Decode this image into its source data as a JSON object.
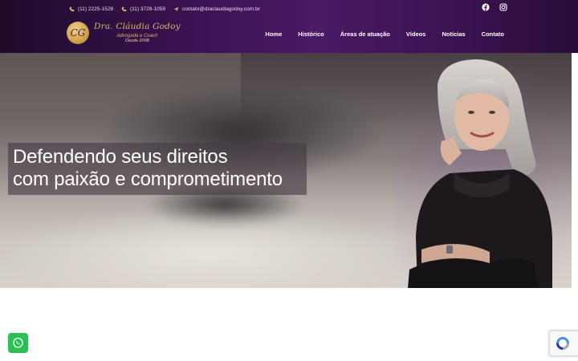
{
  "topbar": {
    "phone1": "(11) 2225-1528",
    "phone2": "(11) 3729-1059",
    "email": "contato@draclaudiagodoy.com.br"
  },
  "social": {
    "facebook_icon": "facebook-icon",
    "instagram_icon": "instagram-icon"
  },
  "logo": {
    "monogram": "CG",
    "name": "Dra. Cláudia Godoy",
    "subtitle": "Advogada e Coach",
    "since": "Desde 2008"
  },
  "nav": {
    "items": [
      "Home",
      "Histórico",
      "Áreas de atuação",
      "Vídeos",
      "Notícias",
      "Contato"
    ]
  },
  "hero": {
    "headline_line1": "Defendendo seus direitos",
    "headline_line2": "com paixão e comprometimento"
  },
  "widgets": {
    "whatsapp_icon": "whatsapp-icon",
    "recaptcha_icon": "recaptcha-icon"
  },
  "colors": {
    "header_purple": "#3c1354",
    "gold": "#d9b76a",
    "whatsapp_green": "#2bbf56"
  }
}
